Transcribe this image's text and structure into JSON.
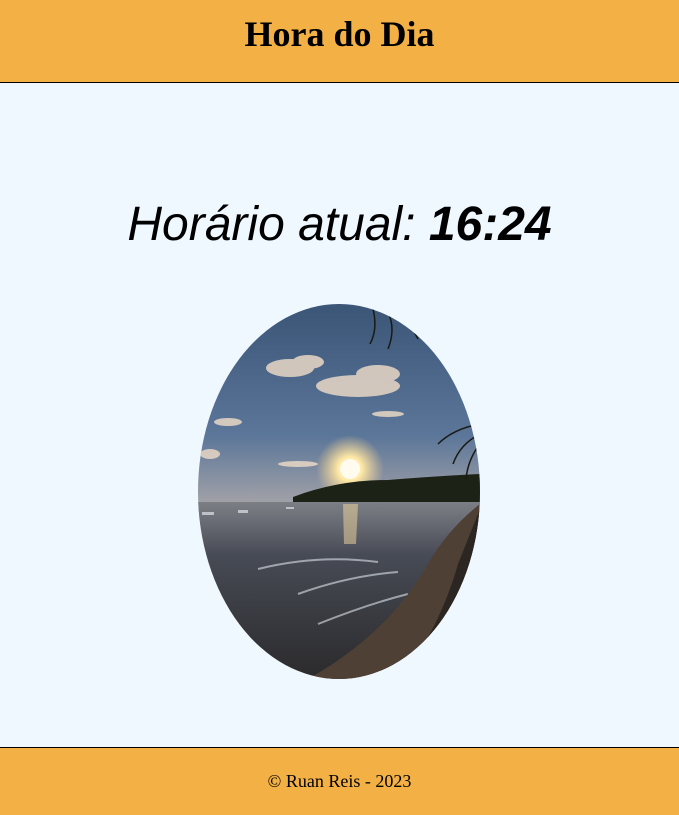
{
  "header": {
    "title": "Hora do Dia"
  },
  "main": {
    "clock_prefix": "Horário atual: ",
    "clock_time": "16:24",
    "photo": {
      "subject": "sunset beach photo"
    }
  },
  "footer": {
    "text": "© Ruan Reis - 2023"
  },
  "colors": {
    "header_footer_bg": "#f2b045",
    "page_bg": "#f0f8ff"
  }
}
